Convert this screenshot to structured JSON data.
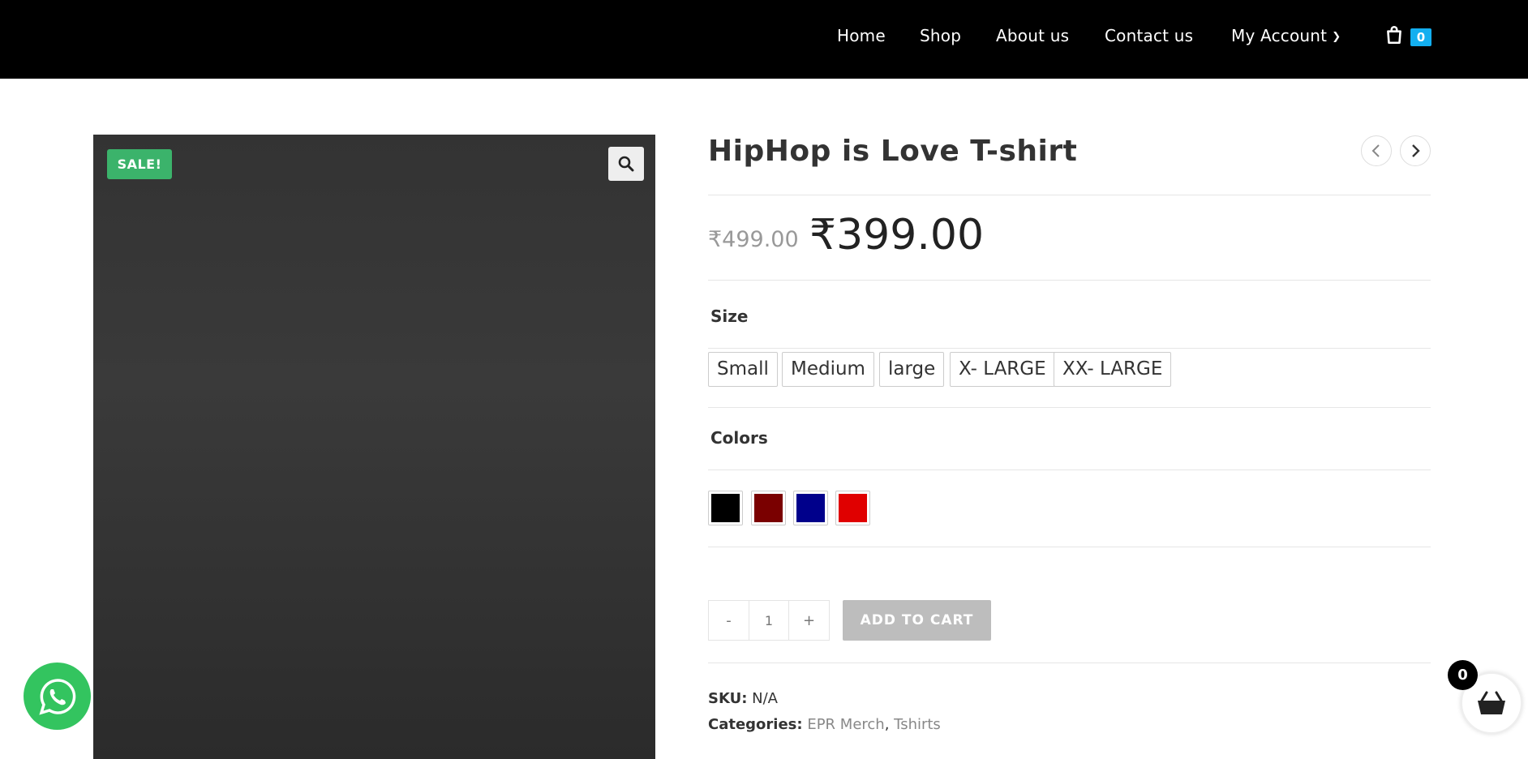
{
  "nav": {
    "items": [
      {
        "label": "Home"
      },
      {
        "label": "Shop"
      },
      {
        "label": "About us"
      },
      {
        "label": "Contact us"
      },
      {
        "label": "My Account"
      }
    ],
    "cart_count": "0"
  },
  "product": {
    "sale_badge": "SALE!",
    "title": "HipHop is Love T-shirt",
    "old_price": "₹499.00",
    "price": "₹399.00",
    "size_label": "Size",
    "sizes": [
      "Small",
      "Medium",
      "large",
      "X- LARGE",
      "XX- LARGE"
    ],
    "colors_label": "Colors",
    "colors": [
      "#000000",
      "#7a0000",
      "#00008b",
      "#e00000"
    ],
    "quantity": "1",
    "minus": "-",
    "plus": "+",
    "add_to_cart": "ADD TO CART",
    "sku_label": "SKU:",
    "sku_value": "N/A",
    "categories_label": "Categories:",
    "categories": [
      "EPR Merch",
      "Tshirts"
    ],
    "category_sep": ","
  },
  "floating": {
    "cart_count": "0"
  }
}
